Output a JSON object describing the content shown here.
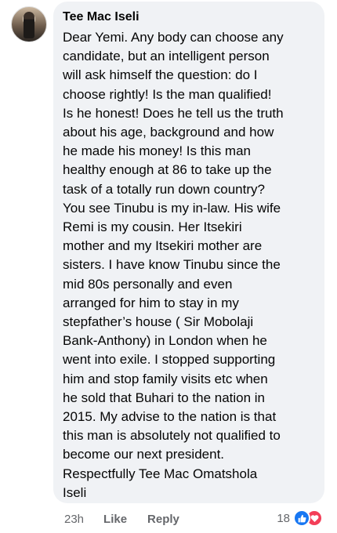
{
  "comment": {
    "author": "Tee Mac Iseli",
    "lines": [
      "Dear Yemi. Any body can choose any",
      "candidate, but an intelligent person",
      "will ask himself the question: do I",
      "choose rightly! Is the man qualified!",
      "Is he honest! Does he tell us the truth",
      "about his age, background and how",
      "he made his money! Is this man",
      "healthy enough at 86 to take up the",
      "task of a totally run down country?",
      "You see Tinubu is my in-law. His wife",
      "Remi is my cousin. Her Itsekiri",
      "mother and my Itsekiri mother are",
      "sisters. I have know Tinubu since the",
      "mid 80s personally and even",
      "arranged for him to stay in my",
      "stepfather’s house ( Sir Mobolaji",
      "Bank-Anthony) in London when he",
      "went into exile. I stopped supporting",
      "him and stop family visits etc when",
      "he sold that Buhari to the nation in",
      "2015. My advise to the nation is that",
      "this man is absolutely not qualified to",
      "become our next president.",
      "Respectfully Tee Mac Omatshola",
      "Iseli"
    ]
  },
  "actions": {
    "time": "23h",
    "like_label": "Like",
    "reply_label": "Reply"
  },
  "reactions": {
    "count": "18",
    "icons": [
      "like-icon",
      "love-icon"
    ],
    "colors": {
      "like": "#1877f2",
      "love": "#f33e58"
    }
  }
}
